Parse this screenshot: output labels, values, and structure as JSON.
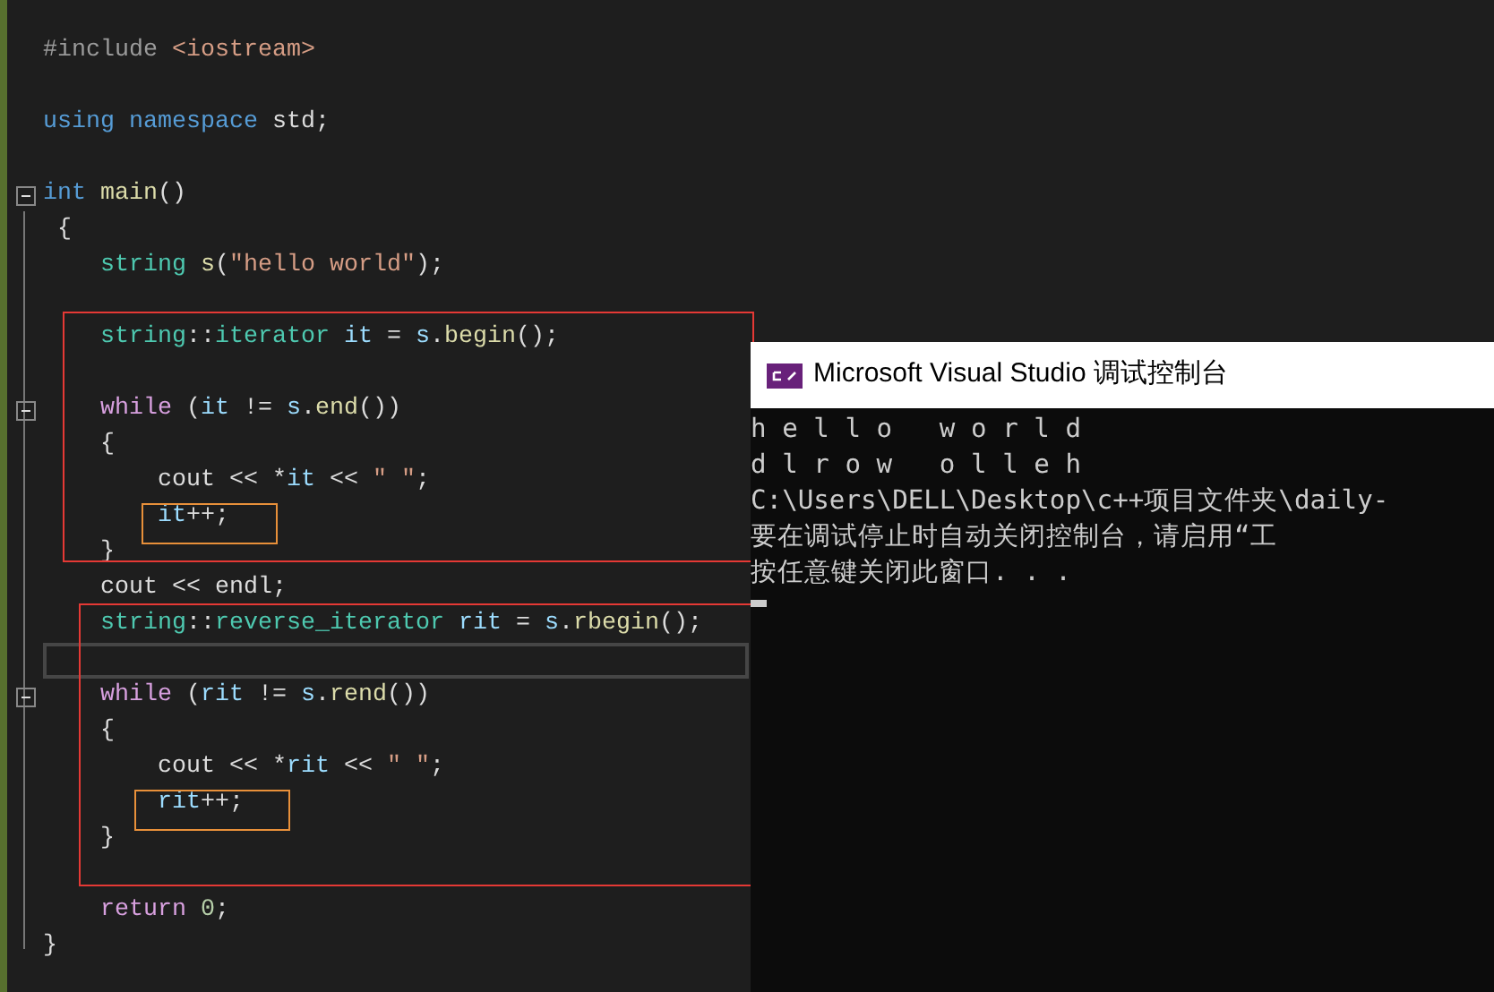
{
  "editor": {
    "blocks": [
      {
        "lines": [
          {
            "tokens": [
              {
                "text": "#include ",
                "kind": "preproc"
              },
              {
                "text": "<iostream>",
                "kind": "string"
              }
            ]
          }
        ]
      },
      {
        "lines": [
          {
            "tokens": [
              {
                "text": "using ",
                "kind": "keyword"
              },
              {
                "text": "namespace ",
                "kind": "keyword"
              },
              {
                "text": "std;",
                "kind": "plain"
              }
            ]
          }
        ]
      },
      {
        "lines": [
          {
            "fold": true,
            "tokens": [
              {
                "text": "int ",
                "kind": "keyword"
              },
              {
                "text": "main",
                "kind": "func"
              },
              {
                "text": "()",
                "kind": "plain"
              }
            ]
          },
          {
            "tokens": [
              {
                "text": " {",
                "kind": "plain"
              }
            ]
          },
          {
            "tokens": [
              {
                "text": "    string ",
                "kind": "type"
              },
              {
                "text": "s",
                "kind": "func"
              },
              {
                "text": "(",
                "kind": "plain"
              },
              {
                "text": "\"hello world\"",
                "kind": "string"
              },
              {
                "text": ");",
                "kind": "plain"
              }
            ]
          }
        ]
      },
      {
        "lines": [
          {
            "tokens": [
              {
                "text": "    string",
                "kind": "type"
              },
              {
                "text": "::",
                "kind": "plain"
              },
              {
                "text": "iterator ",
                "kind": "type"
              },
              {
                "text": "it ",
                "kind": "var"
              },
              {
                "text": "= ",
                "kind": "plain"
              },
              {
                "text": "s",
                "kind": "var"
              },
              {
                "text": ".",
                "kind": "plain"
              },
              {
                "text": "begin",
                "kind": "func"
              },
              {
                "text": "();",
                "kind": "plain"
              }
            ]
          }
        ]
      },
      {
        "lines": [
          {
            "fold": true,
            "tokens": [
              {
                "text": "    while ",
                "kind": "control"
              },
              {
                "text": "(",
                "kind": "plain"
              },
              {
                "text": "it ",
                "kind": "var"
              },
              {
                "text": "!= ",
                "kind": "plain"
              },
              {
                "text": "s",
                "kind": "var"
              },
              {
                "text": ".",
                "kind": "plain"
              },
              {
                "text": "end",
                "kind": "func"
              },
              {
                "text": "())",
                "kind": "plain"
              }
            ]
          },
          {
            "tokens": [
              {
                "text": "    {",
                "kind": "plain"
              }
            ]
          },
          {
            "tokens": [
              {
                "text": "        cout << *",
                "kind": "plain"
              },
              {
                "text": "it",
                "kind": "var"
              },
              {
                "text": " << ",
                "kind": "plain"
              },
              {
                "text": "\" \"",
                "kind": "string"
              },
              {
                "text": ";",
                "kind": "plain"
              }
            ]
          },
          {
            "tokens": [
              {
                "text": "        it",
                "kind": "var"
              },
              {
                "text": "++;",
                "kind": "plain"
              }
            ]
          },
          {
            "tokens": [
              {
                "text": "    }",
                "kind": "plain"
              }
            ]
          },
          {
            "tokens": [
              {
                "text": "    cout << endl;",
                "kind": "plain"
              }
            ]
          },
          {
            "tokens": [
              {
                "text": "    string",
                "kind": "type"
              },
              {
                "text": "::",
                "kind": "plain"
              },
              {
                "text": "reverse_iterator ",
                "kind": "type"
              },
              {
                "text": "rit ",
                "kind": "var"
              },
              {
                "text": "= ",
                "kind": "plain"
              },
              {
                "text": "s",
                "kind": "var"
              },
              {
                "text": ".",
                "kind": "plain"
              },
              {
                "text": "rbegin",
                "kind": "func"
              },
              {
                "text": "();",
                "kind": "plain"
              }
            ]
          },
          {
            "current": true
          },
          {
            "fold": true,
            "tokens": [
              {
                "text": "    while ",
                "kind": "control"
              },
              {
                "text": "(",
                "kind": "plain"
              },
              {
                "text": "rit ",
                "kind": "var"
              },
              {
                "text": "!= ",
                "kind": "plain"
              },
              {
                "text": "s",
                "kind": "var"
              },
              {
                "text": ".",
                "kind": "plain"
              },
              {
                "text": "rend",
                "kind": "func"
              },
              {
                "text": "())",
                "kind": "plain"
              }
            ]
          },
          {
            "tokens": [
              {
                "text": "    {",
                "kind": "plain"
              }
            ]
          },
          {
            "tokens": [
              {
                "text": "        cout << *",
                "kind": "plain"
              },
              {
                "text": "rit",
                "kind": "var"
              },
              {
                "text": " << ",
                "kind": "plain"
              },
              {
                "text": "\" \"",
                "kind": "string"
              },
              {
                "text": ";",
                "kind": "plain"
              }
            ]
          },
          {
            "tokens": [
              {
                "text": "        rit",
                "kind": "var"
              },
              {
                "text": "++;",
                "kind": "plain"
              }
            ]
          },
          {
            "tokens": [
              {
                "text": "    }",
                "kind": "plain"
              }
            ]
          }
        ]
      },
      {
        "lines": [
          {
            "tokens": [
              {
                "text": "    return ",
                "kind": "control"
              },
              {
                "text": "0",
                "kind": "number"
              },
              {
                "text": ";",
                "kind": "plain"
              }
            ]
          },
          {
            "tokens": [
              {
                "text": "}",
                "kind": "plain"
              }
            ]
          }
        ]
      }
    ]
  },
  "console": {
    "title": "Microsoft Visual Studio 调试控制台",
    "lines": [
      "h e l l o   w o r l d",
      "d l r o w   o l l e h",
      "C:\\Users\\DELL\\Desktop\\c++项目文件夹\\daily-",
      "要在调试停止时自动关闭控制台，请启用“工",
      "按任意键关闭此窗口. . ."
    ]
  }
}
